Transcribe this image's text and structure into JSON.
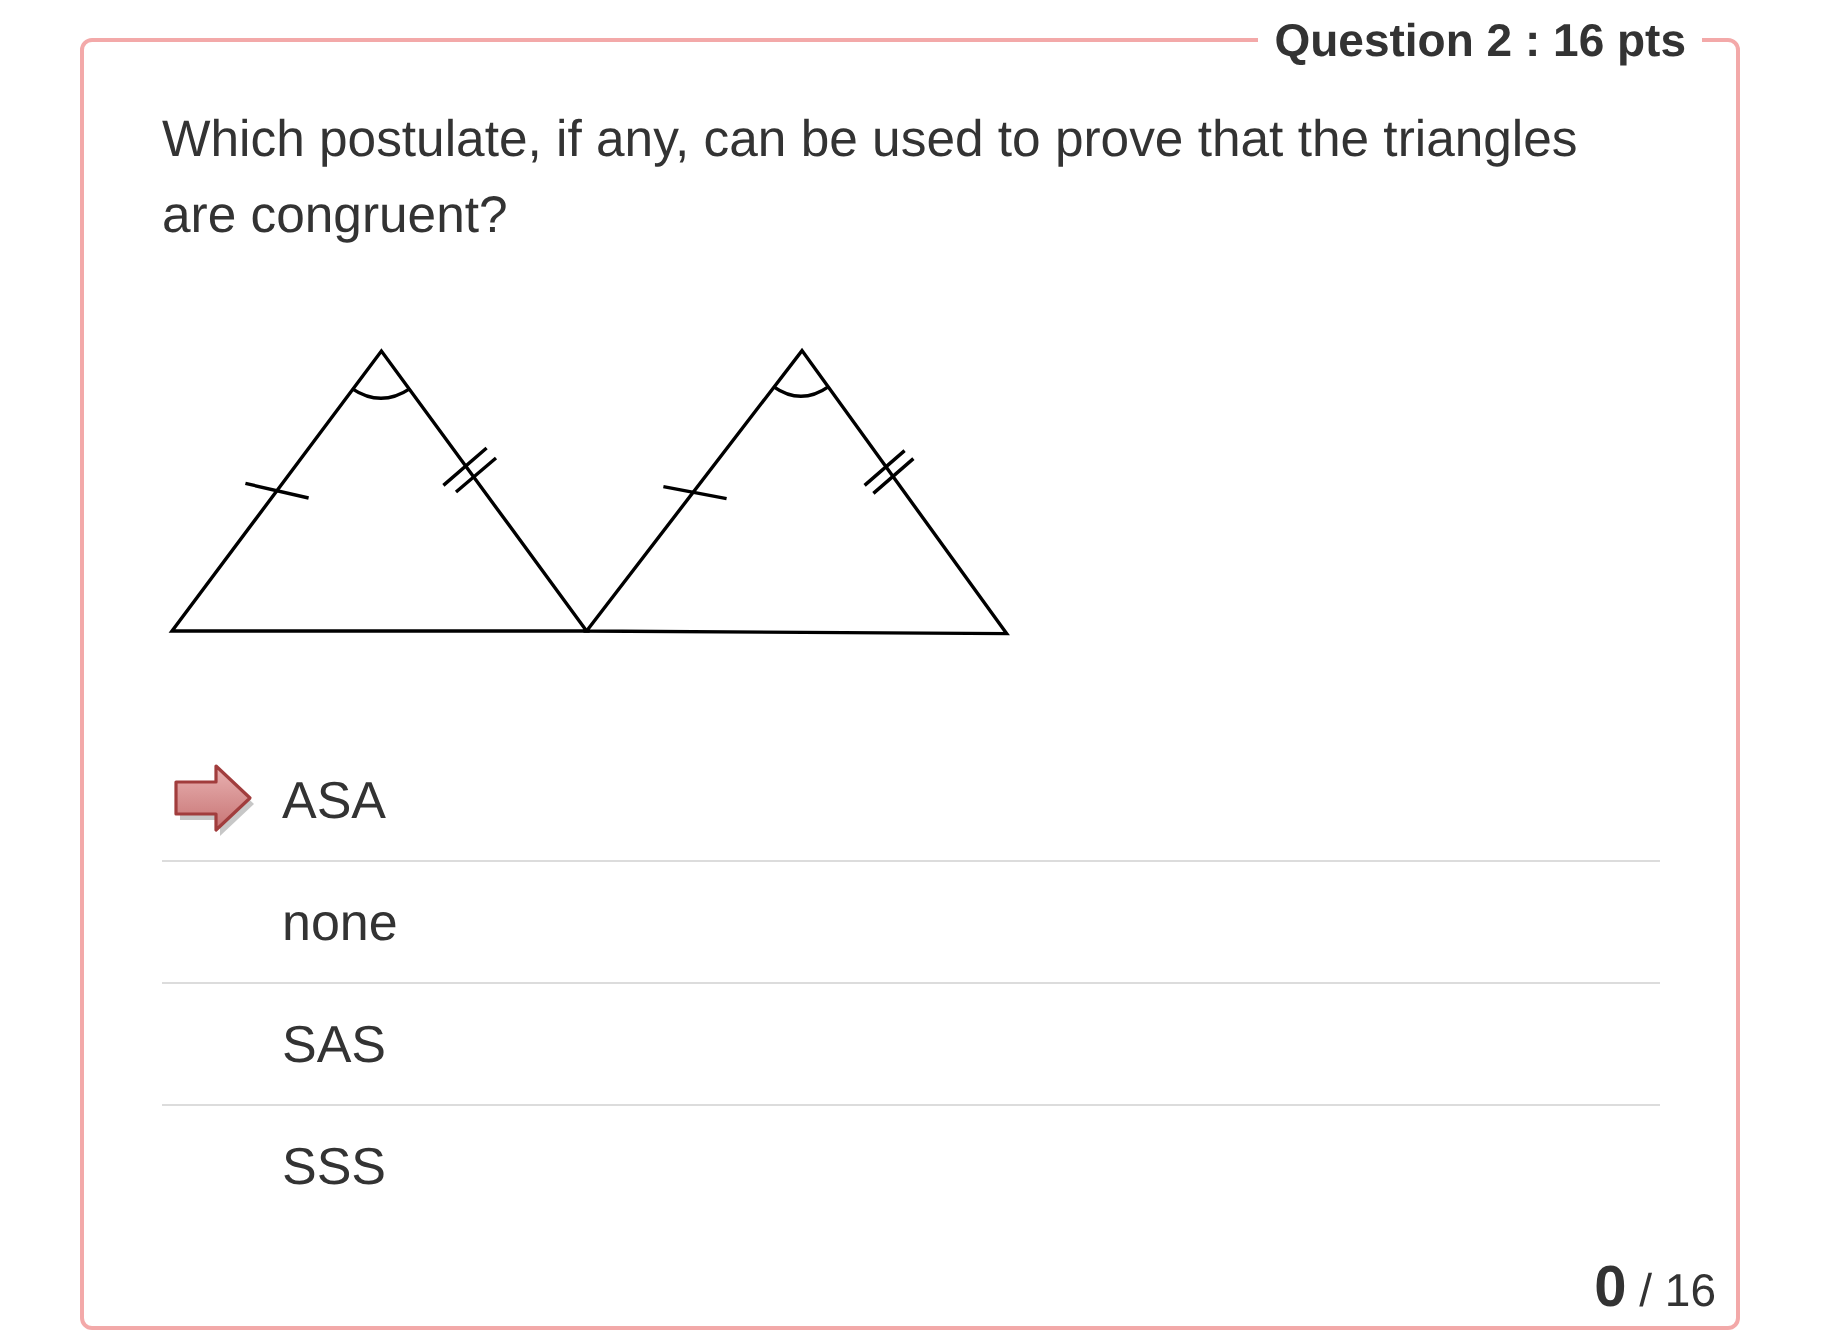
{
  "question": {
    "header": "Question 2 : 16 pts",
    "text": "Which postulate, if any, can be used to prove that the triangles are congruent?",
    "options": [
      {
        "label": "ASA",
        "selected": true
      },
      {
        "label": "none",
        "selected": false
      },
      {
        "label": "SAS",
        "selected": false
      },
      {
        "label": "SSS",
        "selected": false
      }
    ],
    "score": "**0** / 16"
  }
}
